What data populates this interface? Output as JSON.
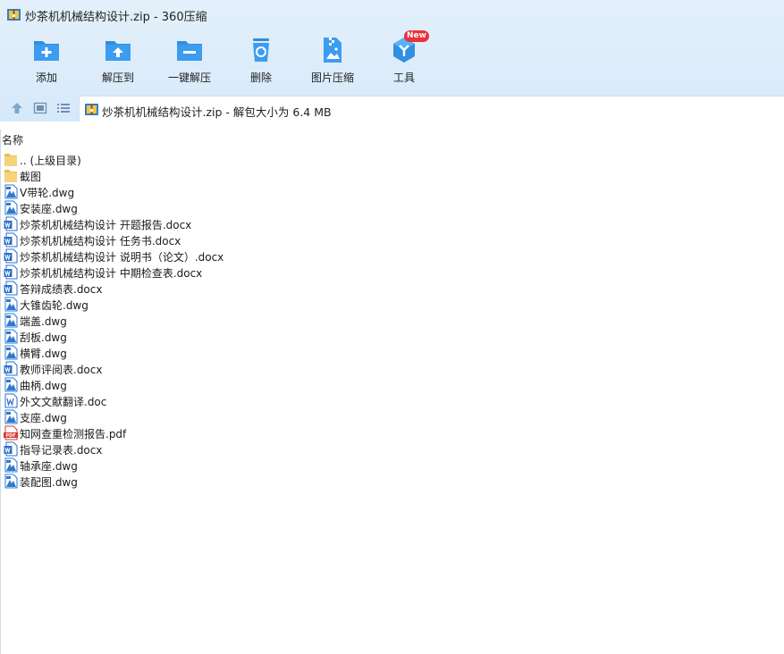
{
  "window": {
    "title": "炒茶机机械结构设计.zip - 360压缩"
  },
  "toolbar": {
    "items": [
      {
        "label": "添加",
        "icon": "add-folder-icon"
      },
      {
        "label": "解压到",
        "icon": "extract-to-icon"
      },
      {
        "label": "一键解压",
        "icon": "one-click-extract-icon"
      },
      {
        "label": "删除",
        "icon": "recycle-bin-icon"
      },
      {
        "label": "图片压缩",
        "icon": "image-compress-icon"
      },
      {
        "label": "工具",
        "icon": "tools-icon"
      }
    ],
    "new_badge": "New"
  },
  "nav": {
    "icons": [
      "up-arrow-icon",
      "thumbnail-view-icon",
      "list-view-icon"
    ],
    "address": "炒茶机机械结构设计.zip - 解包大小为 6.4 MB"
  },
  "list": {
    "column_name": "名称",
    "files": [
      {
        "name": ".. (上级目录)",
        "type": "folder"
      },
      {
        "name": "截图",
        "type": "folder"
      },
      {
        "name": "V带轮.dwg",
        "type": "dwg"
      },
      {
        "name": "安装座.dwg",
        "type": "dwg"
      },
      {
        "name": "炒茶机机械结构设计 开题报告.docx",
        "type": "doc"
      },
      {
        "name": "炒茶机机械结构设计 任务书.docx",
        "type": "doc"
      },
      {
        "name": "炒茶机机械结构设计 说明书（论文）.docx",
        "type": "doc"
      },
      {
        "name": "炒茶机机械结构设计 中期检查表.docx",
        "type": "doc"
      },
      {
        "name": "答辩成绩表.docx",
        "type": "doc"
      },
      {
        "name": "大锥齿轮.dwg",
        "type": "dwg"
      },
      {
        "name": "端盖.dwg",
        "type": "dwg"
      },
      {
        "name": "刮板.dwg",
        "type": "dwg"
      },
      {
        "name": "横臂.dwg",
        "type": "dwg"
      },
      {
        "name": "教师评阅表.docx",
        "type": "doc"
      },
      {
        "name": "曲柄.dwg",
        "type": "dwg"
      },
      {
        "name": "外文文献翻译.doc",
        "type": "doc-old"
      },
      {
        "name": "支座.dwg",
        "type": "dwg"
      },
      {
        "name": "知网查重检测报告.pdf",
        "type": "pdf"
      },
      {
        "name": "指导记录表.docx",
        "type": "doc"
      },
      {
        "name": "轴承座.dwg",
        "type": "dwg"
      },
      {
        "name": "装配图.dwg",
        "type": "dwg"
      }
    ]
  },
  "colors": {
    "toolbar_bg": "#dcecfa",
    "icon_blue": "#2f8fe0",
    "pdf_red": "#d8382f",
    "folder_yellow": "#f6d27a"
  }
}
